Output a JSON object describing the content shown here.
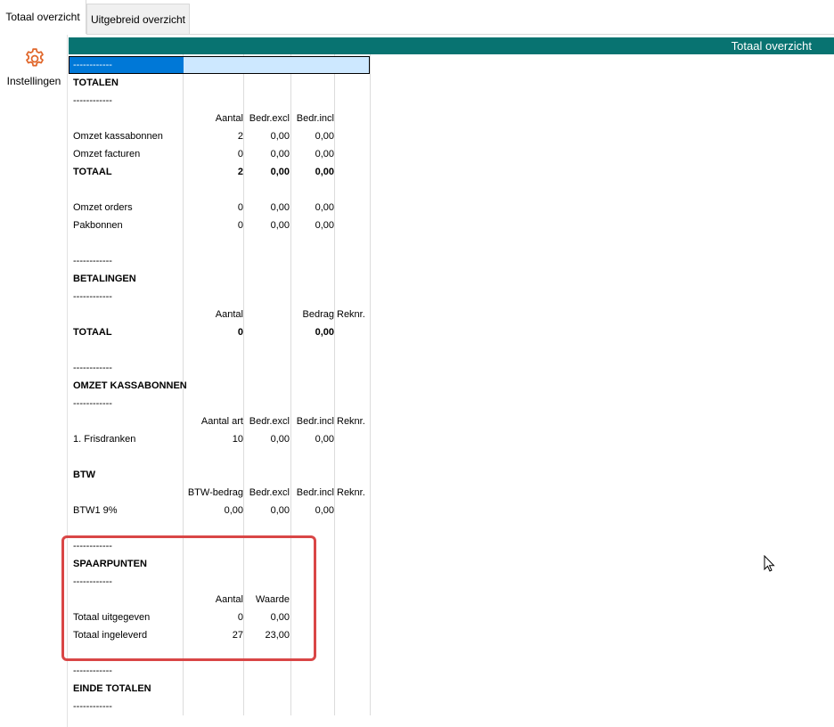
{
  "tabs": [
    {
      "label": "Totaal overzicht",
      "active": true
    },
    {
      "label": "Uitgebreid overzicht",
      "active": false
    }
  ],
  "sidebar": {
    "settings_label": "Instellingen",
    "icon": "gear-icon"
  },
  "header": {
    "title": "Totaal overzicht",
    "color": "#087371"
  },
  "selected_cell": "------------",
  "report": {
    "totalen": {
      "sep1": "------------",
      "title": "TOTALEN",
      "sep2": "------------",
      "headers": [
        "Aantal",
        "Bedr.excl",
        "Bedr.incl"
      ],
      "rows": [
        {
          "label": "Omzet kassabonnen",
          "aantal": "2",
          "excl": "0,00",
          "incl": "0,00"
        },
        {
          "label": "Omzet facturen",
          "aantal": "0",
          "excl": "0,00",
          "incl": "0,00"
        },
        {
          "label": "TOTAAL",
          "aantal": "2",
          "excl": "0,00",
          "incl": "0,00"
        }
      ],
      "extra": [
        {
          "label": "Omzet orders",
          "aantal": "0",
          "excl": "0,00",
          "incl": "0,00"
        },
        {
          "label": "Pakbonnen",
          "aantal": "0",
          "excl": "0,00",
          "incl": "0,00"
        }
      ]
    },
    "betalingen": {
      "sep1": "------------",
      "title": "BETALINGEN",
      "sep2": "------------",
      "headers": [
        "Aantal",
        "Bedrag",
        "Reknr."
      ],
      "total": {
        "label": "TOTAAL",
        "aantal": "0",
        "bedrag": "0,00"
      }
    },
    "omzet_kassabonnen": {
      "sep1": "------------",
      "title": "OMZET KASSABONNEN",
      "sep2": "------------",
      "headers": [
        "Aantal art",
        "Bedr.excl",
        "Bedr.incl",
        "Reknr."
      ],
      "rows": [
        {
          "label": "1. Frisdranken",
          "aantal": "10",
          "excl": "0,00",
          "incl": "0,00"
        }
      ]
    },
    "btw": {
      "title": "BTW",
      "headers": [
        "BTW-bedrag",
        "Bedr.excl",
        "Bedr.incl",
        "Reknr."
      ],
      "rows": [
        {
          "label": "BTW1 9%",
          "bedrag": "0,00",
          "excl": "0,00",
          "incl": "0,00"
        }
      ]
    },
    "spaarpunten": {
      "sep1": "------------",
      "title": "SPAARPUNTEN",
      "sep2": "------------",
      "headers": [
        "Aantal",
        "Waarde"
      ],
      "rows": [
        {
          "label": "Totaal uitgegeven",
          "aantal": "0",
          "waarde": "0,00"
        },
        {
          "label": "Totaal ingeleverd",
          "aantal": "27",
          "waarde": "23,00"
        }
      ]
    },
    "einde": {
      "sep1": "------------",
      "title": "EINDE TOTALEN",
      "sep2": "------------"
    }
  },
  "highlight_color": "#d94646"
}
